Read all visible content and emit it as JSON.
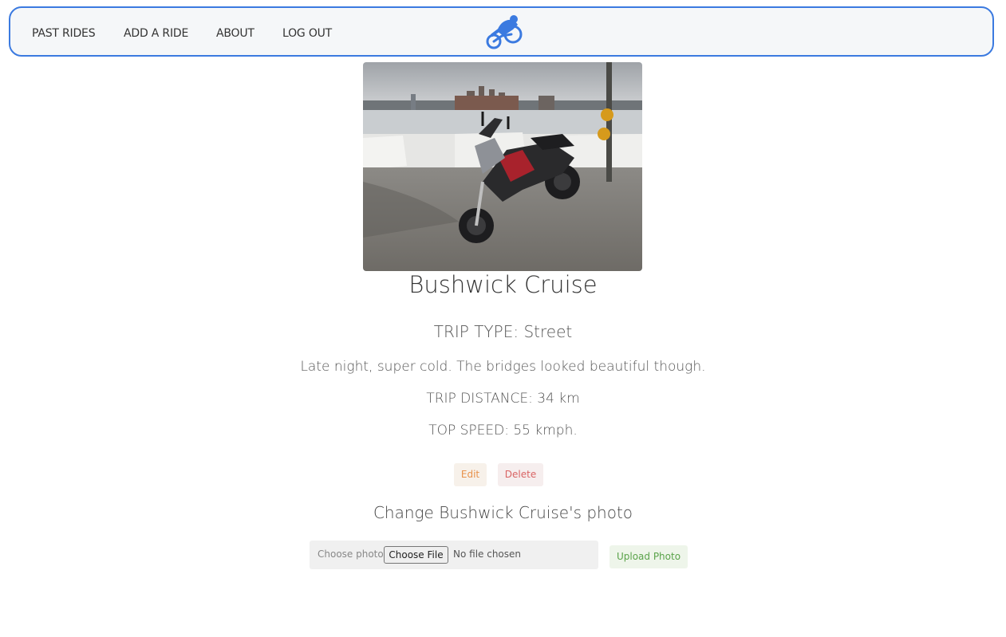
{
  "nav": {
    "links": [
      "PAST RIDES",
      "ADD A RIDE",
      "ABOUT",
      "LOG OUT"
    ],
    "logo_icon": "motorcycle-rider-icon",
    "accent_color": "#3b7ae0"
  },
  "ride": {
    "title": "Bushwick Cruise",
    "trip_type": "TRIP TYPE: Street",
    "description": "Late night, super cold. The bridges looked beautiful though.",
    "distance": "TRIP DISTANCE: 34 km",
    "top_speed": "TOP SPEED: 55 kmph."
  },
  "actions": {
    "edit_label": "Edit",
    "delete_label": "Delete"
  },
  "photo_form": {
    "heading": "Change Bushwick Cruise's photo",
    "label": "Choose photo",
    "choose_button": "Choose File",
    "file_status": "No file chosen",
    "upload_label": "Upload Photo"
  }
}
